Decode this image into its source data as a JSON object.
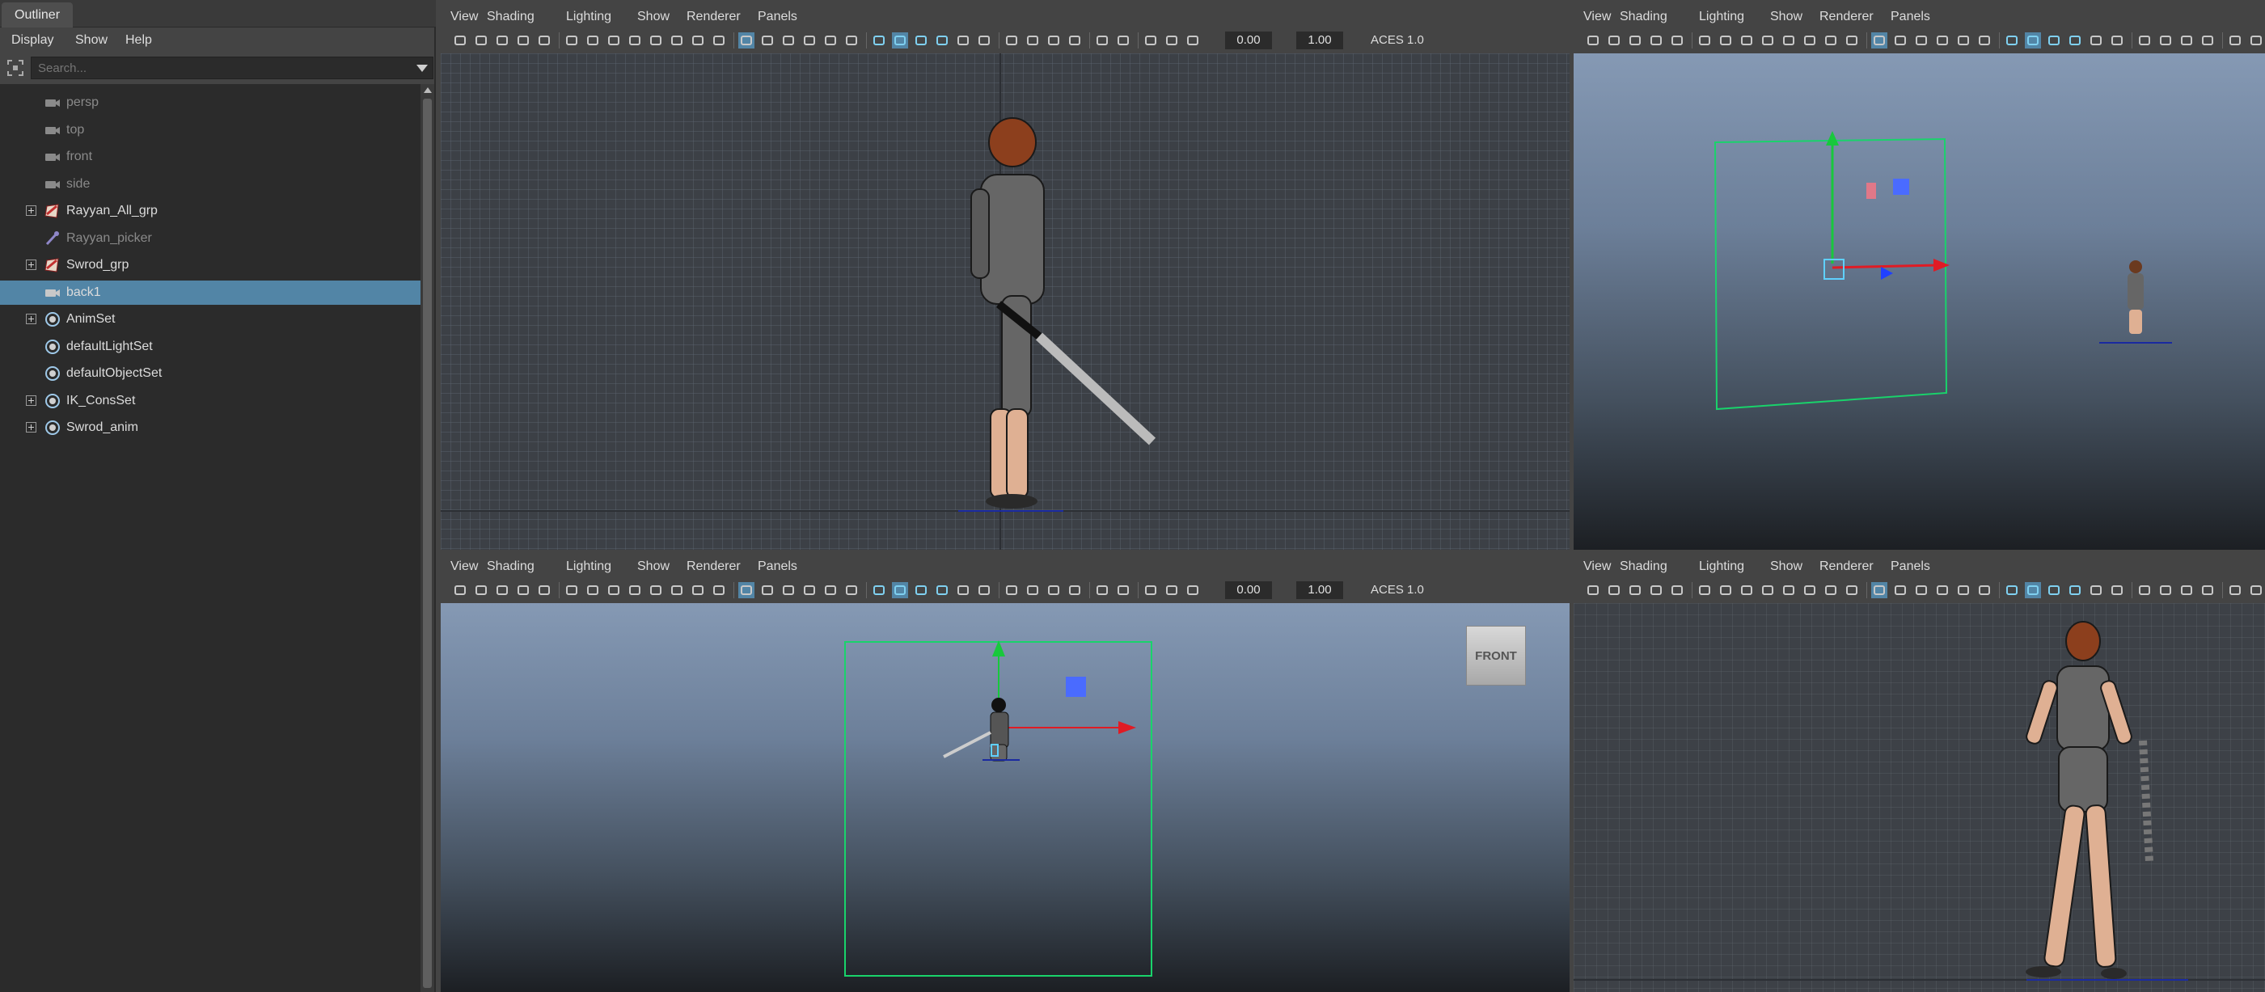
{
  "outliner": {
    "tab_label": "Outliner",
    "menus": [
      "Display",
      "Show",
      "Help"
    ],
    "search_placeholder": "Search...",
    "items": [
      {
        "label": "persp",
        "icon": "camera-icon",
        "expandable": false,
        "dim": true,
        "selected": false
      },
      {
        "label": "top",
        "icon": "camera-icon",
        "expandable": false,
        "dim": true,
        "selected": false
      },
      {
        "label": "front",
        "icon": "camera-icon",
        "expandable": false,
        "dim": true,
        "selected": false
      },
      {
        "label": "side",
        "icon": "camera-icon",
        "expandable": false,
        "dim": true,
        "selected": false
      },
      {
        "label": "Rayyan_All_grp",
        "icon": "group-icon",
        "expandable": true,
        "dim": false,
        "selected": false
      },
      {
        "label": "Rayyan_picker",
        "icon": "picker-icon",
        "expandable": false,
        "dim": true,
        "selected": false
      },
      {
        "label": "Swrod_grp",
        "icon": "group-icon",
        "expandable": true,
        "dim": false,
        "selected": false
      },
      {
        "label": "back1",
        "icon": "camera-icon",
        "expandable": false,
        "dim": false,
        "selected": true
      },
      {
        "label": "AnimSet",
        "icon": "set-icon",
        "expandable": true,
        "dim": false,
        "selected": false
      },
      {
        "label": "defaultLightSet",
        "icon": "set-icon",
        "expandable": false,
        "dim": false,
        "selected": false
      },
      {
        "label": "defaultObjectSet",
        "icon": "set-icon",
        "expandable": false,
        "dim": false,
        "selected": false
      },
      {
        "label": "IK_ConsSet",
        "icon": "set-icon",
        "expandable": true,
        "dim": false,
        "selected": false
      },
      {
        "label": "Swrod_anim",
        "icon": "set-icon",
        "expandable": true,
        "dim": false,
        "selected": false
      }
    ]
  },
  "viewports": [
    {
      "id": "vp-top-left",
      "menus": [
        "View",
        "Shading",
        "Lighting",
        "Show",
        "Renderer",
        "Panels"
      ],
      "exposure": "0.00",
      "gamma": "1.00",
      "color_space": "ACES 1.0",
      "view_cube": ""
    },
    {
      "id": "vp-top-right",
      "menus": [
        "View",
        "Shading",
        "Lighting",
        "Show",
        "Renderer",
        "Panels"
      ],
      "exposure": "",
      "gamma": "",
      "color_space": "",
      "view_cube": ""
    },
    {
      "id": "vp-bottom-left",
      "menus": [
        "View",
        "Shading",
        "Lighting",
        "Show",
        "Renderer",
        "Panels"
      ],
      "exposure": "0.00",
      "gamma": "1.00",
      "color_space": "ACES 1.0",
      "view_cube": "FRONT"
    },
    {
      "id": "vp-bottom-right",
      "menus": [
        "View",
        "Shading",
        "Lighting",
        "Show",
        "Renderer",
        "Panels"
      ],
      "exposure": "",
      "gamma": "",
      "color_space": "",
      "view_cube": ""
    }
  ],
  "colors": {
    "selection": "#5285a6",
    "accent_blue": "#4aa0d0",
    "camera_frame": "#19d36b",
    "axis_x": "#e01b24",
    "axis_y": "#18c83c",
    "axis_z": "#2040ff"
  }
}
